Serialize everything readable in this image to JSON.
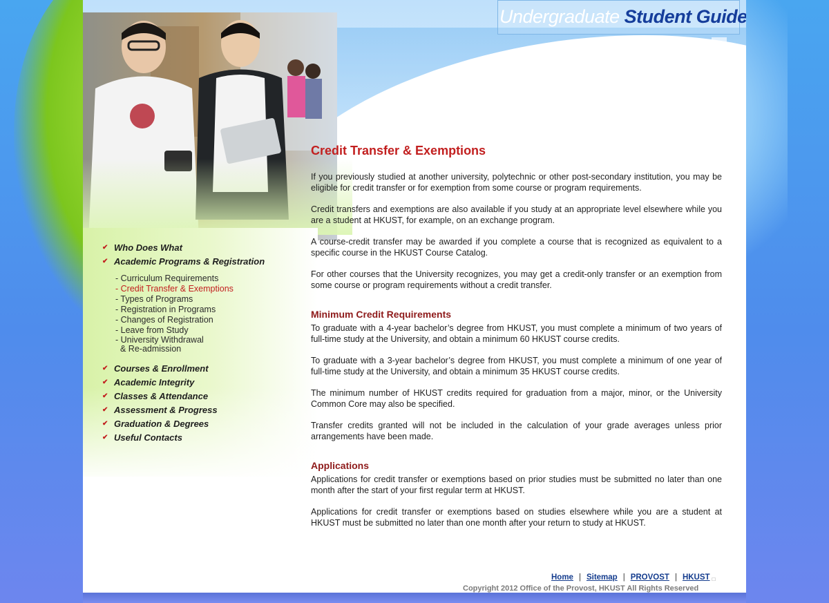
{
  "site": {
    "logo_part1": "Undergraduate ",
    "logo_part2": "Student Guide"
  },
  "nav": {
    "group1": [
      {
        "label": "Who Does What"
      },
      {
        "label": "Academic Programs & Registration"
      }
    ],
    "sub": [
      {
        "label": "- Curriculum Requirements"
      },
      {
        "label": "- Credit Transfer & Exemptions"
      },
      {
        "label": "- Types of Programs"
      },
      {
        "label": "- Registration in Programs"
      },
      {
        "label": "- Changes of Registration"
      },
      {
        "label": "- Leave from Study"
      },
      {
        "label": "- University Withdrawal",
        "label2": "& Re-admission"
      }
    ],
    "group2": [
      {
        "label": "Courses & Enrollment"
      },
      {
        "label": "Academic Integrity"
      },
      {
        "label": "Classes & Attendance"
      },
      {
        "label": "Assessment & Progress"
      },
      {
        "label": "Graduation & Degrees"
      },
      {
        "label": "Useful Contacts"
      }
    ]
  },
  "content": {
    "title": "Credit Transfer & Exemptions",
    "intro": [
      "If you previously studied at another university, polytechnic or other post-secondary institution, you may be eligible for credit transfer or for exemption from some course or program requirements.",
      "Credit transfers and exemptions are also available if you study at an appropriate level elsewhere while you are a student at HKUST, for example, on an exchange program.",
      "A course-credit transfer may be awarded if you complete a course that is recognized as equivalent to a specific course in the HKUST Course Catalog.",
      "For other courses that the University recognizes, you may get a credit-only transfer or an exemption from some course or program requirements without a credit transfer."
    ],
    "section1_title": "Minimum Credit Requirements",
    "section1": [
      "To graduate with a 4-year bachelor’s degree from HKUST, you must complete a minimum of two years of full-time study at the University, and obtain a minimum 60 HKUST course credits.",
      "To graduate with a 3-year bachelor’s degree from HKUST, you must complete a minimum of one year of full-time study at the University, and obtain a minimum 35 HKUST course credits.",
      "The minimum number of HKUST credits required for graduation from a major, minor, or the University Common Core may also be specified.",
      "Transfer credits granted will not be included in the calculation of your grade averages unless prior arrangements have been made."
    ],
    "section2_title": "Applications",
    "section2": [
      "Applications for credit transfer or exemptions based on prior studies must be submitted no later than one month after the start of your first regular term at HKUST.",
      "Applications for credit transfer or exemptions based on studies elsewhere while you are a student at HKUST must be submitted no later than one month after your return to study at HKUST."
    ]
  },
  "footer": {
    "links": [
      "Home",
      "Sitemap",
      "PROVOST",
      "HKUST"
    ],
    "separator": "|",
    "copyright": "Copyright 2012 Office of the Provost, HKUST   All Rights Reserved"
  },
  "colors": {
    "accent_red": "#c21f1f",
    "heading_dark_red": "#8e1a1a",
    "logo_blue": "#153d9b",
    "link_blue": "#143c8e",
    "bg_blue": "#4f8cec",
    "panel_green": "#d8f2a8"
  },
  "icons": {
    "nav_marker": "chevron-down-icon",
    "external_link": "external-link-icon"
  }
}
